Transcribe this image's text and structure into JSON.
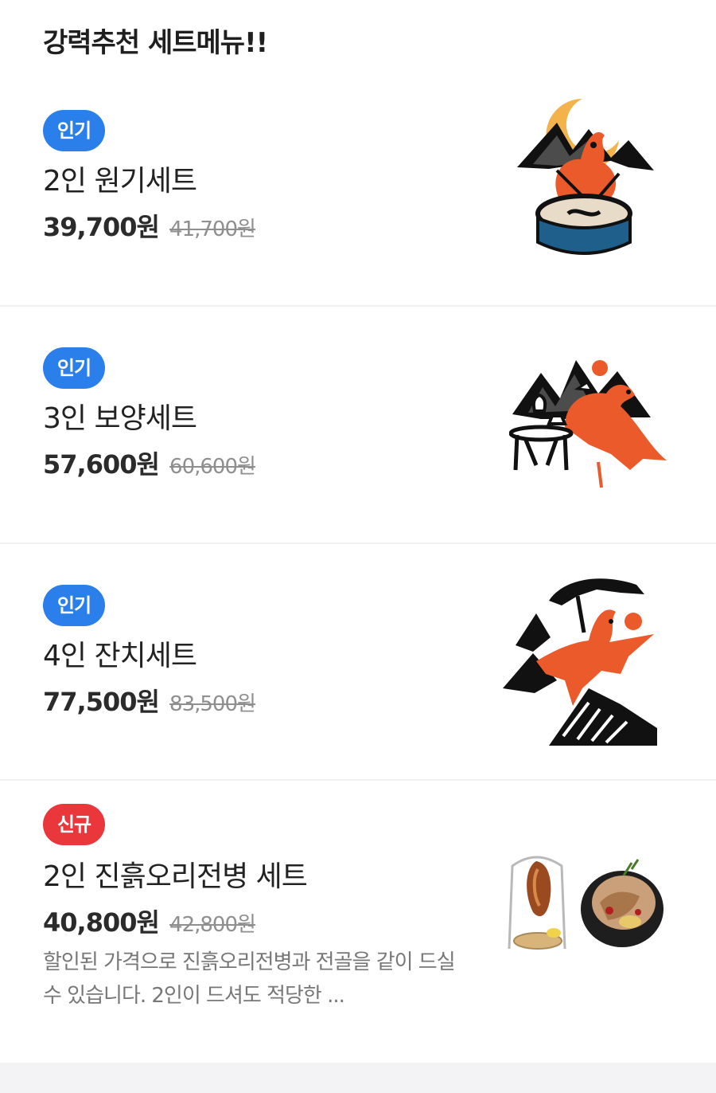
{
  "section_title": "강력추천 세트메뉴!!",
  "menu_items": [
    {
      "badge": "인기",
      "badge_color": "#2a7fea",
      "name": "2인 원기세트",
      "price": "39,700원",
      "original_price": "41,700원",
      "image": "hot-pot-duck-illustration"
    },
    {
      "badge": "인기",
      "badge_color": "#2a7fea",
      "name": "3인 보양세트",
      "price": "57,600원",
      "original_price": "60,600원",
      "image": "duck-drinking-illustration"
    },
    {
      "badge": "인기",
      "badge_color": "#2a7fea",
      "name": "4인 잔치세트",
      "price": "77,500원",
      "original_price": "83,500원",
      "image": "flying-bird-mountain-illustration"
    },
    {
      "badge": "신규",
      "badge_color": "#e9373c",
      "name": "2인 진흙오리전병 세트",
      "price": "40,800원",
      "original_price": "42,800원",
      "description": "할인된 가격으로 진흙오리전병과 전골을 같이 드실 수 있습니다. 2인이 드셔도 적당한 ...",
      "image": "roast-duck-and-stew-photo"
    }
  ],
  "colors": {
    "accent_blue": "#2a7fea",
    "accent_red": "#e9373c",
    "illustration_orange": "#ea5a2a"
  }
}
